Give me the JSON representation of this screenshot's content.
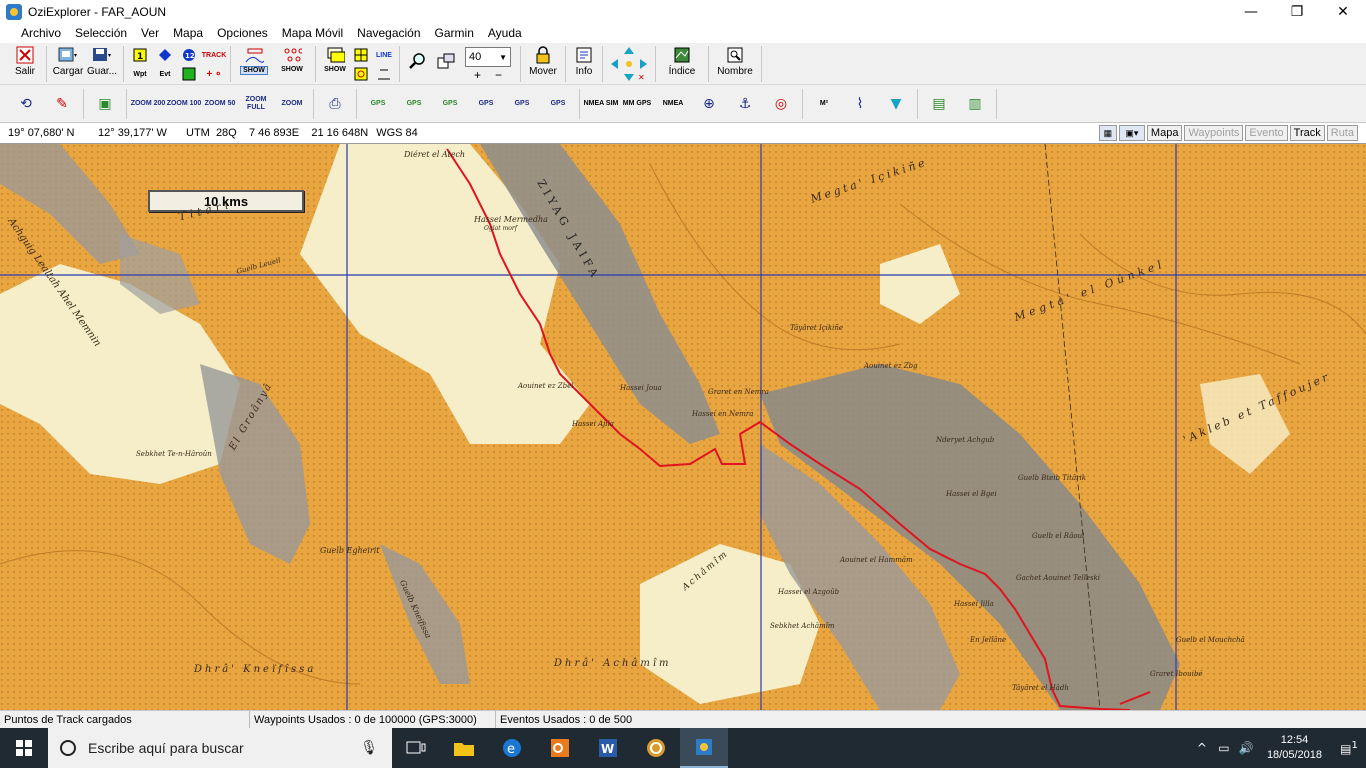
{
  "window": {
    "title": "OziExplorer - FAR_AOUN",
    "minimize": "—",
    "maximize": "❐",
    "close": "✕"
  },
  "menu": [
    "Archivo",
    "Selección",
    "Ver",
    "Mapa",
    "Opciones",
    "Mapa Móvil",
    "Navegación",
    "Garmin",
    "Ayuda"
  ],
  "toolbar1": {
    "exit": "Salir",
    "load": "Cargar",
    "save": "Guar...",
    "wpt": "Wpt",
    "evt": "Evt",
    "track_label": "TRACK",
    "show": "SHOW",
    "zoom_value": "40",
    "move": "Mover",
    "info": "Info",
    "index": "Índice",
    "name": "Nombre"
  },
  "toolbar2": {
    "zoom200": "ZOOM 200",
    "zoom100": "ZOOM 100",
    "zoom50": "ZOOM 50",
    "zoomfull": "ZOOM FULL",
    "zoom": "ZOOM",
    "gps": "GPS",
    "nmea_sim": "NMEA SIM",
    "mm_gps": "MM GPS",
    "nmea": "NMEA",
    "m2": "M²"
  },
  "infobar": {
    "lat": "19° 07,680' N",
    "lon": "12° 39,177' W",
    "utm": "UTM  28Q    7 46 893E    21 16 648N",
    "datum": "WGS 84",
    "tabs": [
      {
        "label": "Mapa",
        "enabled": true
      },
      {
        "label": "Waypoints",
        "enabled": false
      },
      {
        "label": "Evento",
        "enabled": false
      },
      {
        "label": "Track",
        "enabled": true
      },
      {
        "label": "Ruta",
        "enabled": false
      }
    ]
  },
  "map": {
    "scale_label": "10 kms",
    "labels": [
      "Diéret el Atech",
      "Hassei Mermedha",
      "Oglat morf",
      "Guelb Leueil",
      "Achguig Lealtah Ahel Memnin",
      "Megta' Içikiñe",
      "Megta' el Oûnkel",
      "Tâyâret Içikiñe",
      "Aouinet ez Zbel",
      "Hassei Joua",
      "Graret en Nemra",
      "Hassei en Nemra",
      "Hassei Ajila",
      "Sebkhet Te-n-Hâroûn",
      "El Groânyâ",
      "Guelb Egheirit",
      "Guelb Kneifissa",
      "Dhrâ' Kneïfîssa",
      "Dhrâ' Achâmîm",
      "Achâmîm",
      "Hassei el Azgoûb",
      "Sebkhet Achâmîm",
      "Aouinet ez Zbg",
      "Nderyet Achgub",
      "Guelb Bteib Titârik",
      "Hassei el Bgei",
      "Guelb el Râoul",
      "Gachet Aouinet Telleski",
      "Hassei Jilla",
      "En Jelîâne",
      "Guelb el Mouchchâ",
      "Graret Ibouibé",
      "Tâyâret el Hâdh",
      "'Akleb et Taffoujer",
      "Aouinet el Hammâm",
      "Titâri",
      "ZIYAG JAIFA"
    ]
  },
  "status": {
    "track": "Puntos de Track cargados",
    "waypoints": "Waypoints Usados : 0 de 100000  (GPS:3000)",
    "events": "Eventos Usados : 0 de 500"
  },
  "taskbar": {
    "search_placeholder": "Escribe aquí para buscar",
    "time": "12:54",
    "date": "18/05/2018",
    "notifications": "1"
  },
  "colors": {
    "track": "#e0141e",
    "grid": "#2a3ab0",
    "terrain": "#e8a540",
    "relief": "#8e8e8e",
    "sand": "#f6eec8"
  }
}
